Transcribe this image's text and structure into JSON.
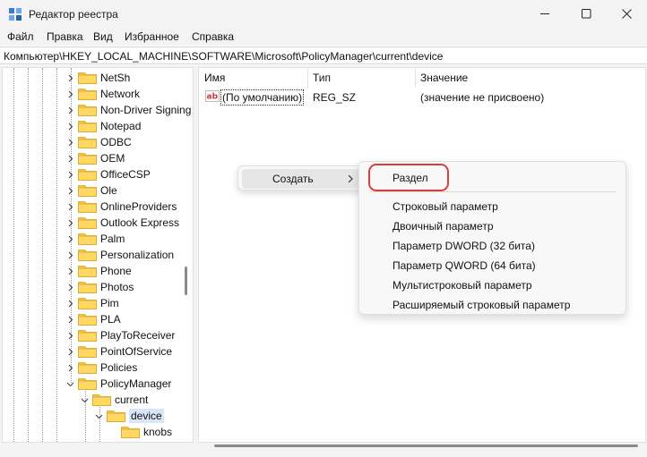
{
  "window": {
    "title": "Редактор реестра",
    "minimize_icon": "minimize-icon",
    "maximize_icon": "maximize-icon",
    "close_icon": "close-icon"
  },
  "menu": [
    "Файл",
    "Правка",
    "Вид",
    "Избранное",
    "Справка"
  ],
  "address": "Компьютер\\HKEY_LOCAL_MACHINE\\SOFTWARE\\Microsoft\\PolicyManager\\current\\device",
  "tree": {
    "items": [
      {
        "label": "NetSh",
        "expandable": true
      },
      {
        "label": "Network",
        "expandable": true
      },
      {
        "label": "Non-Driver Signing",
        "expandable": true
      },
      {
        "label": "Notepad",
        "expandable": true
      },
      {
        "label": "ODBC",
        "expandable": true
      },
      {
        "label": "OEM",
        "expandable": true
      },
      {
        "label": "OfficeCSP",
        "expandable": true
      },
      {
        "label": "Ole",
        "expandable": true
      },
      {
        "label": "OnlineProviders",
        "expandable": true
      },
      {
        "label": "Outlook Express",
        "expandable": true
      },
      {
        "label": "Palm",
        "expandable": true
      },
      {
        "label": "Personalization",
        "expandable": true
      },
      {
        "label": "Phone",
        "expandable": true
      },
      {
        "label": "Photos",
        "expandable": true
      },
      {
        "label": "Pim",
        "expandable": true
      },
      {
        "label": "PLA",
        "expandable": true
      },
      {
        "label": "PlayToReceiver",
        "expandable": true
      },
      {
        "label": "PointOfService",
        "expandable": true
      },
      {
        "label": "Policies",
        "expandable": true
      },
      {
        "label": "PolicyManager",
        "expanded": true
      },
      {
        "label": "current",
        "expanded": true
      },
      {
        "label": "device",
        "expanded": true,
        "selected": true
      },
      {
        "label": "knobs",
        "expandable": false
      }
    ]
  },
  "values": {
    "columns": [
      "Имя",
      "Тип",
      "Значение"
    ],
    "rows": [
      {
        "name": "(По умолчанию)",
        "type": "REG_SZ",
        "data": "(значение не присвоено)"
      }
    ]
  },
  "context_menu": {
    "create": "Создать"
  },
  "submenu": {
    "items": [
      "Раздел",
      "Строковый параметр",
      "Двоичный параметр",
      "Параметр DWORD (32 бита)",
      "Параметр QWORD (64 бита)",
      "Мультистроковый параметр",
      "Расширяемый строковый параметр"
    ]
  },
  "colors": {
    "folder": "#f5c542",
    "highlight_ring": "#e23b3b",
    "selection": "#d9e6f7"
  }
}
